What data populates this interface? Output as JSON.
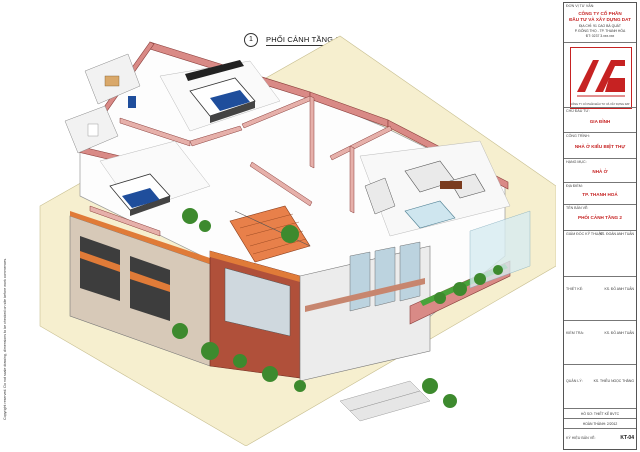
{
  "title": {
    "number": "1",
    "label": "PHỐI CẢNH TẦNG 2"
  },
  "side_note": "Copyright reserved. Do not scale drawing, dimensions to be checked on site before work commences.",
  "title_block": {
    "company_label": "ĐƠN VỊ TƯ VẤN:",
    "company_name_1": "CÔNG TY CỔ PHẦN",
    "company_name_2": "ĐẦU TƯ VÀ XÂY DỰNG DAT",
    "company_info": [
      "ĐỊA CHỈ: 91 CAO BÁ QUÁT",
      "P. ĐÔNG THỌ - TP. THANH HÓA",
      "ĐT: 0237 3.xxx.xxx"
    ],
    "logo_caption": "CÔNG TY CỔ PHẦN ĐẦU TƯ VÀ XÂY DỰNG DAT",
    "owner_label": "CHỦ ĐẦU TƯ:",
    "owner_value": "GIA ĐÌNH",
    "project_label": "CÔNG TRÌNH:",
    "project_value": "NHÀ Ở KIỂU BIỆT THỰ",
    "category_label": "HẠNG MỤC:",
    "category_value": "NHÀ Ở",
    "location_label": "ĐỊA ĐIỂM:",
    "location_value": "TP. THANH HOÁ",
    "drawing_label": "TÊN BẢN VẼ:",
    "drawing_value": "PHỐI CẢNH TẦNG 2",
    "director_label": "GIÁM ĐỐC KỸ THUẬT",
    "director_value": "KS. ĐOÀN ANH TUẤN",
    "designer_label": "THIẾT KẾ:",
    "designer_value": "KS. ĐỖ ANH TUẤN",
    "checker_label": "KIỂM TRA:",
    "checker_value": "KS. ĐỖ ANH TUẤN",
    "manager_label": "QUẢN LÝ:",
    "manager_value": "KS. THIỀU NGỌC THẮNG",
    "file_label": "HỒ SƠ: THIẾT KẾ BVTC",
    "date_label": "HOÀN THÀNH: 2/2012",
    "sheet_label": "KÝ HIỆU BẢN VẼ:",
    "sheet_value": "KT-04"
  }
}
